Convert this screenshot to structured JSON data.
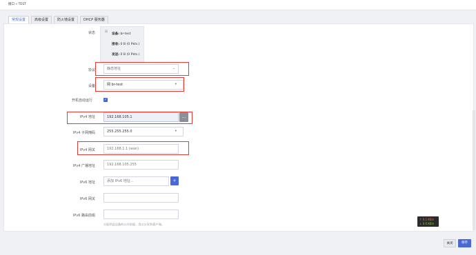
{
  "header": {
    "title": "接口 » TEST"
  },
  "tabs": [
    {
      "label": "常规设置",
      "active": true
    },
    {
      "label": "高级设置",
      "active": false
    },
    {
      "label": "防火墙设置",
      "active": false
    },
    {
      "label": "DHCP 服务器",
      "active": false
    }
  ],
  "form": {
    "status_label": "状态",
    "status": {
      "device_icon": "网",
      "device_label": "设备:",
      "device_value": "br-test",
      "rx_label": "接收:",
      "rx_value": "0 B (0 Pkts.)",
      "tx_label": "发送:",
      "tx_value": "0 B (0 Pkts.)"
    },
    "protocol_label": "协议",
    "protocol_value": "静态地址",
    "device_label": "设备",
    "device_value": "网 br-test",
    "autostart_label": "开机自动运行",
    "autostart_checked": true,
    "ipv4_label": "IPv4 地址",
    "ipv4_value": "192.168.105.1",
    "ipv4_mask_label": "IPv4 子网掩码",
    "ipv4_mask_value": "255.255.255.0",
    "ipv4_gateway_label": "IPv4 网关",
    "ipv4_gateway_placeholder": "192.168.1.1 (wan)",
    "ipv4_broadcast_label": "IPv4 广播地址",
    "ipv4_broadcast_placeholder": "192.168.105.255",
    "ipv6_label": "IPv6 地址",
    "ipv6_placeholder": "添加 IPv6 地址...",
    "ipv6_gateway_label": "IPv6 网关",
    "ipv6_prefix_label": "IPv6 路由前缀",
    "ipv6_prefix_hint": "分配到此设备的公共前缀，用以分发到客户端。",
    "ipv4_add_symbol": "...",
    "ipv6_add_symbol": "+"
  },
  "traffic": {
    "up": "↑ 0.1 KB/s",
    "down": "↓ 0.6 KB/s"
  },
  "footer": {
    "close_label": "关闭",
    "save_label": "保存"
  },
  "colors": {
    "accent": "#4a67d6",
    "highlight": "#e53935"
  }
}
